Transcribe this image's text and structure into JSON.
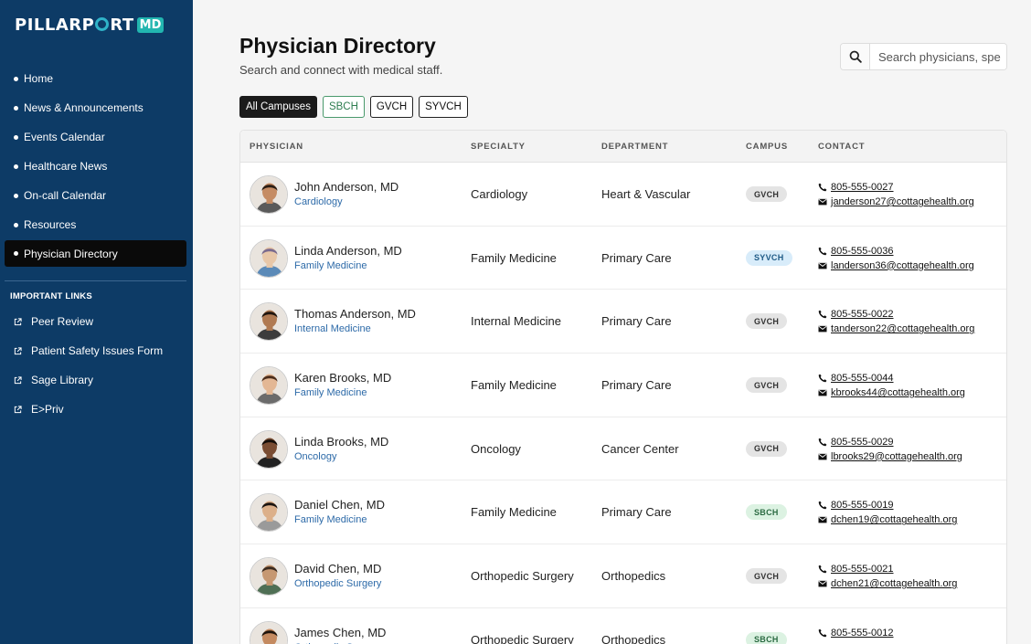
{
  "app": {
    "logo_text_before": "PILLARP",
    "logo_text_after": "RT",
    "logo_badge": "MD"
  },
  "sidebar": {
    "nav": [
      {
        "label": "Home",
        "active": false
      },
      {
        "label": "News & Announcements",
        "active": false
      },
      {
        "label": "Events Calendar",
        "active": false
      },
      {
        "label": "Healthcare News",
        "active": false
      },
      {
        "label": "On-call Calendar",
        "active": false
      },
      {
        "label": "Resources",
        "active": false
      },
      {
        "label": "Physician Directory",
        "active": true
      }
    ],
    "links_title": "IMPORTANT LINKS",
    "links": [
      {
        "label": "Peer Review",
        "icon": "external-link-icon"
      },
      {
        "label": "Patient Safety Issues Form",
        "icon": "external-link-icon"
      },
      {
        "label": "Sage Library",
        "icon": "external-link-icon"
      },
      {
        "label": "E>Priv",
        "icon": "external-link-icon"
      }
    ]
  },
  "header": {
    "title": "Physician Directory",
    "subtitle": "Search and connect with medical staff.",
    "search_placeholder": "Search physicians, spe"
  },
  "filters": [
    {
      "label": "All Campuses",
      "active": true
    },
    {
      "label": "SBCH",
      "active": false
    },
    {
      "label": "GVCH",
      "active": false
    },
    {
      "label": "SYVCH",
      "active": false
    }
  ],
  "table": {
    "headers": [
      "PHYSICIAN",
      "SPECIALTY",
      "DEPARTMENT",
      "CAMPUS",
      "CONTACT"
    ],
    "rows": [
      {
        "name": "John Anderson, MD",
        "specialty": "Cardiology",
        "department": "Heart & Vascular",
        "campus": "GVCH",
        "phone": "805-555-0027",
        "email": "janderson27@cottagehealth.org",
        "skin": "#c58c64",
        "hair": "#2a1d14",
        "shirt": "#5a5a5a"
      },
      {
        "name": "Linda Anderson, MD",
        "specialty": "Family Medicine",
        "department": "Primary Care",
        "campus": "SYVCH",
        "phone": "805-555-0036",
        "email": "landerson36@cottagehealth.org",
        "skin": "#e8c7a8",
        "hair": "#7a6a8e",
        "shirt": "#5b8ab8"
      },
      {
        "name": "Thomas Anderson, MD",
        "specialty": "Internal Medicine",
        "department": "Primary Care",
        "campus": "GVCH",
        "phone": "805-555-0022",
        "email": "tanderson22@cottagehealth.org",
        "skin": "#b07a52",
        "hair": "#1f150e",
        "shirt": "#3c3c3c"
      },
      {
        "name": "Karen Brooks, MD",
        "specialty": "Family Medicine",
        "department": "Primary Care",
        "campus": "GVCH",
        "phone": "805-555-0044",
        "email": "kbrooks44@cottagehealth.org",
        "skin": "#e3b794",
        "hair": "#4a2c1a",
        "shirt": "#6b6b6b"
      },
      {
        "name": "Linda Brooks, MD",
        "specialty": "Oncology",
        "department": "Cancer Center",
        "campus": "GVCH",
        "phone": "805-555-0029",
        "email": "lbrooks29@cottagehealth.org",
        "skin": "#7a4d33",
        "hair": "#120c08",
        "shirt": "#222222"
      },
      {
        "name": "Daniel Chen, MD",
        "specialty": "Family Medicine",
        "department": "Primary Care",
        "campus": "SBCH",
        "phone": "805-555-0019",
        "email": "dchen19@cottagehealth.org",
        "skin": "#dcb08a",
        "hair": "#1a1410",
        "shirt": "#9a9a9a"
      },
      {
        "name": "David Chen, MD",
        "specialty": "Orthopedic Surgery",
        "department": "Orthopedics",
        "campus": "GVCH",
        "phone": "805-555-0021",
        "email": "dchen21@cottagehealth.org",
        "skin": "#c69872",
        "hair": "#3a2a1e",
        "shirt": "#4f6f55"
      },
      {
        "name": "James Chen, MD",
        "specialty": "Orthopedic Surgery",
        "department": "Orthopedics",
        "campus": "SBCH",
        "phone": "805-555-0012",
        "email": "",
        "skin": "#c48a60",
        "hair": "#1e140c",
        "shirt": "#2a2a2a"
      }
    ]
  },
  "colors": {
    "sidebar_bg": "#0d3b66",
    "active_nav_bg": "#0a0a0a",
    "link_blue": "#2d6aa8",
    "badge_gvch": "#e4e4e4",
    "badge_syvch": "#d8ecfa",
    "badge_sbch": "#dcf2e2"
  }
}
